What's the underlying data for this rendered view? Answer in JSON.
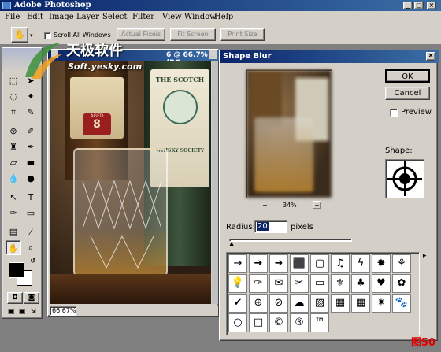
{
  "app": {
    "title": "Adobe Photoshop"
  },
  "window_buttons": [
    "_",
    "□",
    "×"
  ],
  "menu": [
    "File",
    "Edit",
    "Image",
    "Layer",
    "Select",
    "Filter",
    "View",
    "Window",
    "Help"
  ],
  "options": {
    "scroll_all_windows": "Scroll All Windows",
    "actual_pixels": "Actual Pixels",
    "fit_screen": "Fit Screen",
    "print_size": "Print Size"
  },
  "watermark": {
    "line1": "天极软件",
    "line2": "Soft.yesky.com"
  },
  "document": {
    "title": "6 @ 66.7% (RG...",
    "zoom": "66.67%",
    "label_top": "THE SCOTCH",
    "label_whisky": "WHISKY SOCIETY",
    "label_aged": "AGED",
    "label_years": "YEARS",
    "label_num": "8"
  },
  "dialog": {
    "title": "Shape Blur",
    "ok": "OK",
    "cancel": "Cancel",
    "preview_label": "Preview",
    "preview_checked": false,
    "zoom": "34%",
    "zoom_minus": "−",
    "zoom_plus": "+",
    "radius_label": "Radius:",
    "radius_value": "20",
    "radius_unit": "pixels",
    "shape_label": "Shape:",
    "shapes": [
      "→",
      "➔",
      "➜",
      "⬛",
      "▢",
      "♫",
      "ϟ",
      "✸",
      "⚘",
      "💡",
      "✑",
      "✉",
      "✂",
      "▭",
      "⚜",
      "♣",
      "♥",
      "✿",
      "✔",
      "⊕",
      "⊘",
      "☁",
      "▨",
      "▦",
      "▦",
      "✷",
      "🐾",
      "○",
      "□",
      "©",
      "®",
      "™"
    ]
  },
  "figure_label": "图50",
  "colors": {
    "titlebar": "#0a246a",
    "figure_label": "#e00000"
  }
}
